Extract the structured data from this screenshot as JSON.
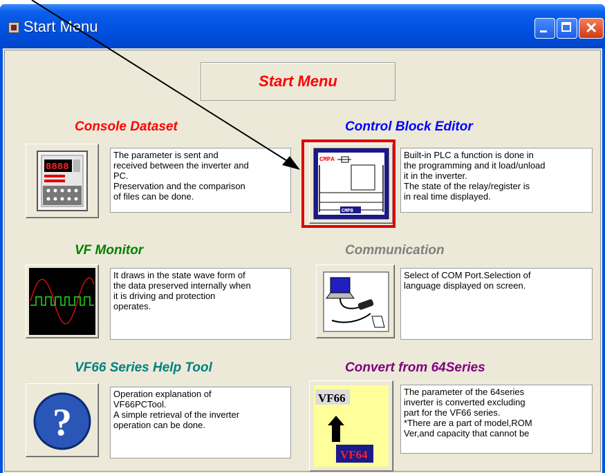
{
  "window": {
    "title": "Start Menu"
  },
  "header": {
    "title": "Start Menu"
  },
  "sections": {
    "console": {
      "title": "Console Dataset",
      "description": "The parameter is sent and\nreceived between the inverter and\nPC.\nPreservation and the comparison\nof files can be done.",
      "display_digits": "8888",
      "color": "#ff0000"
    },
    "control": {
      "title": "Control Block Editor",
      "description": "Built-in PLC a function is done in\nthe programming and it load/unload\nit in the inverter.\nThe state of the relay/register is\nin real time displayed.",
      "icon_label_top": "CMPA",
      "icon_label_bottom": "CMPB",
      "color": "#0000ff"
    },
    "vf_monitor": {
      "title": "VF Monitor",
      "description": "It draws in the state wave form of\nthe data preserved internally when\nit is driving and protection\noperates.",
      "color": "#008000"
    },
    "communication": {
      "title": "Communication",
      "description": "Select of COM Port.Selection of\nlanguage displayed on screen.",
      "color": "#808080"
    },
    "help": {
      "title": "VF66 Series Help Tool",
      "description": "Operation explanation of\nVF66PCTool.\nA simple retrieval of the inverter\noperation can be done.",
      "icon_symbol": "?",
      "color": "#008080"
    },
    "convert": {
      "title": "Convert from 64Series",
      "description": "The parameter of the 64series\ninverter is converted excluding\npart for the VF66 series.\n*There are a part of model,ROM\nVer,and capacity that cannot be",
      "icon_label_top": "VF66",
      "icon_label_bottom": "VF64",
      "color": "#800080"
    }
  }
}
